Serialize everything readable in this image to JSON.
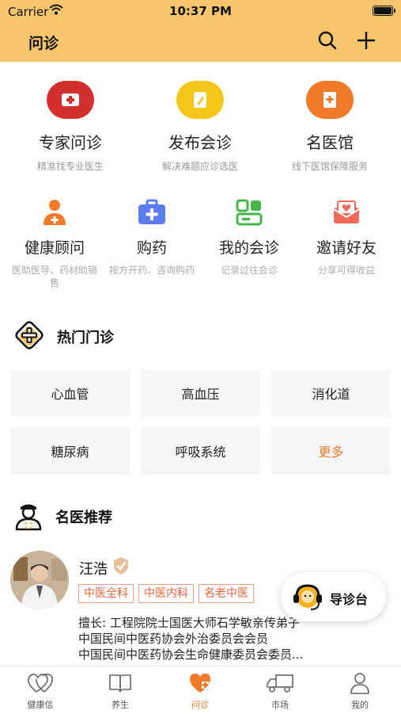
{
  "status_bar": {
    "carrier": "Carrier",
    "time": "10:37 PM"
  },
  "header": {
    "title": "问诊"
  },
  "primary_services": [
    {
      "title": "专家问诊",
      "subtitle": "精准找专业医生",
      "color": "#d32f2f"
    },
    {
      "title": "发布会诊",
      "subtitle": "解决难题应诊选医",
      "color": "#f5c518"
    },
    {
      "title": "名医馆",
      "subtitle": "线下医馆保障服务",
      "color": "#f07a2a"
    }
  ],
  "secondary_services": [
    {
      "title": "健康顾问",
      "subtitle": "医助医导、药材助销售"
    },
    {
      "title": "购药",
      "subtitle": "按方开药、咨询购药"
    },
    {
      "title": "我的会诊",
      "subtitle": "记录过往会诊"
    },
    {
      "title": "邀请好友",
      "subtitle": "分享可得收益"
    }
  ],
  "hot_departments": {
    "title": "热门门诊",
    "items": [
      "心血管",
      "高血压",
      "消化道",
      "糖尿病",
      "呼吸系统",
      "更多"
    ]
  },
  "recommended": {
    "title": "名医推荐",
    "doctor": {
      "name": "汪浩",
      "tags": [
        "中医全科",
        "中医内科",
        "名老中医"
      ],
      "desc_lines": [
        "擅长: 工程院院士国医大师石学敏亲传弟子",
        "中国民间中医药协会外治委员会会员",
        "中国民间中医药协会生命健康委员会委员..."
      ]
    }
  },
  "floating": {
    "label": "导诊台"
  },
  "tabbar": [
    {
      "label": "健康信",
      "icon": "heart-outline-icon"
    },
    {
      "label": "养生",
      "icon": "book-icon"
    },
    {
      "label": "问诊",
      "icon": "heart-plus-icon",
      "active": true
    },
    {
      "label": "市场",
      "icon": "truck-icon"
    },
    {
      "label": "我的",
      "icon": "person-icon"
    }
  ],
  "colors": {
    "header_bg": "#f7c66c",
    "accent": "#f07a2a"
  }
}
